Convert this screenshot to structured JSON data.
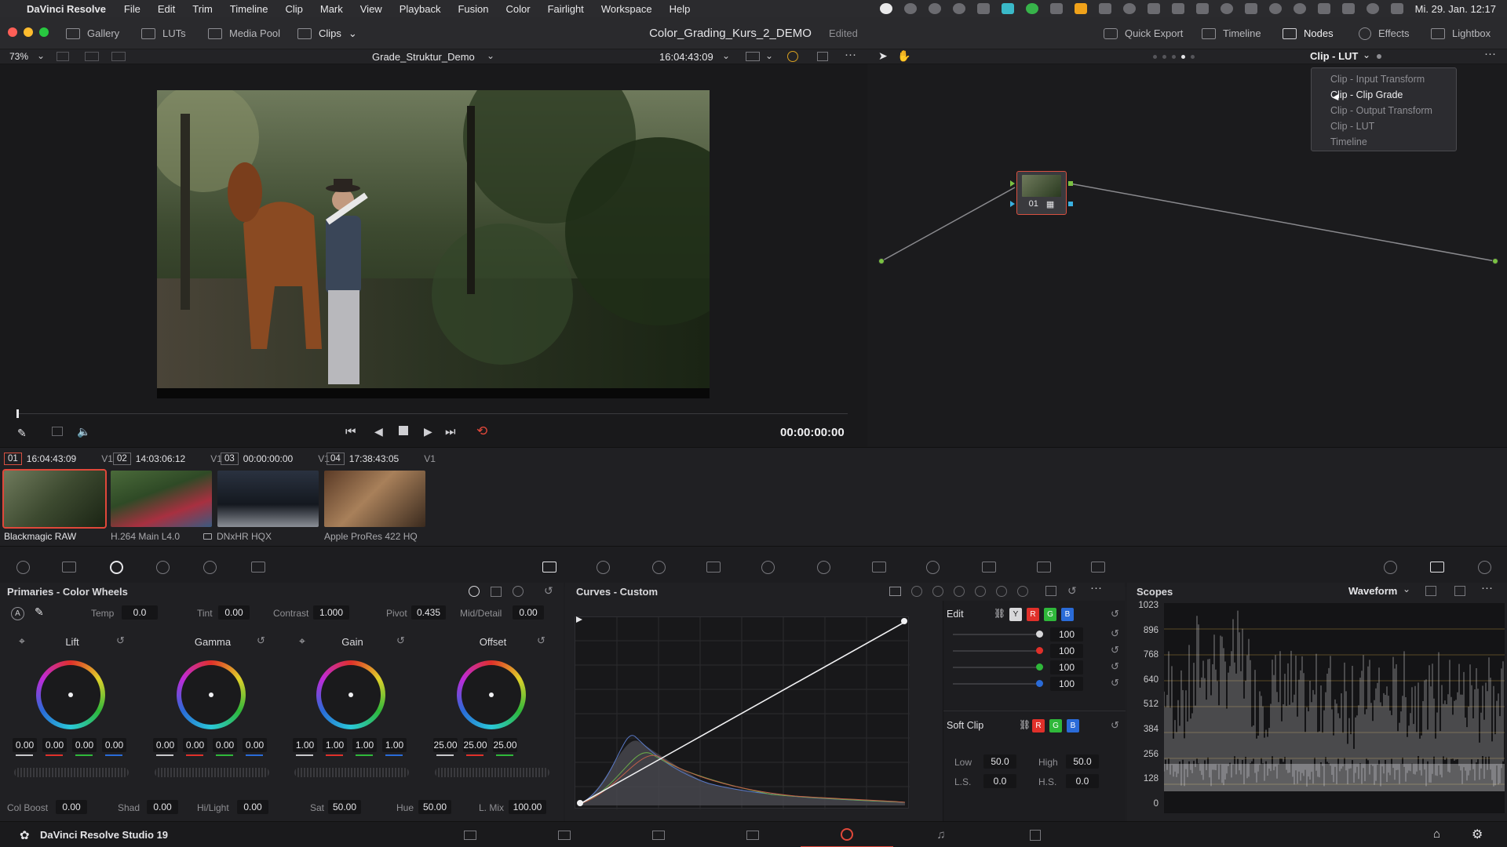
{
  "menubar": {
    "app": "DaVinci Resolve",
    "items": [
      "File",
      "Edit",
      "Trim",
      "Timeline",
      "Clip",
      "Mark",
      "View",
      "Playback",
      "Fusion",
      "Color",
      "Fairlight",
      "Workspace",
      "Help"
    ],
    "clock": "Mi. 29. Jan.  12:17"
  },
  "titlebar": {
    "gallery": "Gallery",
    "luts": "LUTs",
    "media_pool": "Media Pool",
    "clips": "Clips",
    "project": "Color_Grading_Kurs_2_DEMO",
    "status": "Edited",
    "quick_export": "Quick Export",
    "timeline": "Timeline",
    "nodes": "Nodes",
    "effects": "Effects",
    "lightbox": "Lightbox"
  },
  "viewer": {
    "zoom": "73%",
    "timeline_name": "Grade_Struktur_Demo",
    "timecode": "16:04:43:09",
    "playhead_tc": "00:00:00:00"
  },
  "nodes": {
    "stage": "Clip - LUT",
    "node_label": "01",
    "menu": [
      "Clip - Input Transform",
      "Clip - Clip Grade",
      "Clip - Output Transform",
      "Clip - LUT",
      "Timeline"
    ],
    "menu_active": 1
  },
  "clips": [
    {
      "num": "01",
      "tc": "16:04:43:09",
      "track": "V1",
      "codec": "Blackmagic RAW"
    },
    {
      "num": "02",
      "tc": "14:03:06:12",
      "track": "V1",
      "codec": "H.264 Main L4.0"
    },
    {
      "num": "03",
      "tc": "00:00:00:00",
      "track": "V1",
      "codec": "DNxHR HQX"
    },
    {
      "num": "04",
      "tc": "17:38:43:05",
      "track": "V1",
      "codec": "Apple ProRes 422 HQ"
    }
  ],
  "primaries": {
    "title": "Primaries - Color Wheels",
    "temp_label": "Temp",
    "temp": "0.0",
    "tint_label": "Tint",
    "tint": "0.00",
    "contrast_label": "Contrast",
    "contrast": "1.000",
    "pivot_label": "Pivot",
    "pivot": "0.435",
    "middetail_label": "Mid/Detail",
    "middetail": "0.00",
    "wheels": [
      {
        "name": "Lift",
        "values": [
          "0.00",
          "0.00",
          "0.00",
          "0.00"
        ]
      },
      {
        "name": "Gamma",
        "values": [
          "0.00",
          "0.00",
          "0.00",
          "0.00"
        ]
      },
      {
        "name": "Gain",
        "values": [
          "1.00",
          "1.00",
          "1.00",
          "1.00"
        ]
      },
      {
        "name": "Offset",
        "values": [
          "25.00",
          "25.00",
          "25.00"
        ]
      }
    ],
    "colboost_label": "Col Boost",
    "colboost": "0.00",
    "shad_label": "Shad",
    "shad": "0.00",
    "hilight_label": "Hi/Light",
    "hilight": "0.00",
    "sat_label": "Sat",
    "sat": "50.00",
    "hue_label": "Hue",
    "hue": "50.00",
    "lmix_label": "L. Mix",
    "lmix": "100.00"
  },
  "curves": {
    "title": "Curves - Custom",
    "edit_label": "Edit",
    "channels": [
      "Y",
      "R",
      "G",
      "B"
    ],
    "channel_colors": [
      "#d8d8da",
      "#e0302a",
      "#2fb83a",
      "#2a6bd8"
    ],
    "edit_values": [
      "100",
      "100",
      "100",
      "100"
    ],
    "softclip_label": "Soft Clip",
    "low_label": "Low",
    "low": "50.0",
    "high_label": "High",
    "high": "50.0",
    "ls_label": "L.S.",
    "ls": "0.0",
    "hs_label": "H.S.",
    "hs": "0.0"
  },
  "scopes": {
    "title": "Scopes",
    "mode": "Waveform",
    "scale": [
      "1023",
      "896",
      "768",
      "640",
      "512",
      "384",
      "256",
      "128",
      "0"
    ]
  },
  "footer": {
    "product": "DaVinci Resolve Studio 19"
  }
}
